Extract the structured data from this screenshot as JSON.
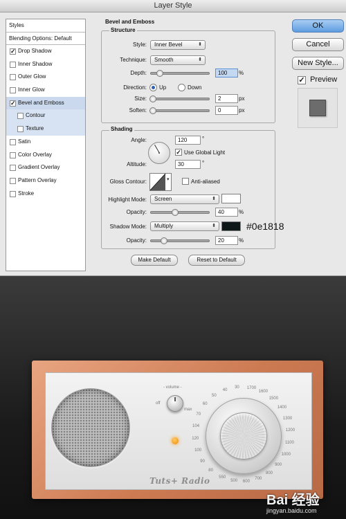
{
  "dialog": {
    "title": "Layer Style",
    "styles_header": "Styles",
    "blending_options": "Blending Options: Default",
    "style_items": [
      {
        "label": "Drop Shadow",
        "checked": true,
        "selected": false,
        "sub": false
      },
      {
        "label": "Inner Shadow",
        "checked": false,
        "selected": false,
        "sub": false
      },
      {
        "label": "Outer Glow",
        "checked": false,
        "selected": false,
        "sub": false
      },
      {
        "label": "Inner Glow",
        "checked": false,
        "selected": false,
        "sub": false
      },
      {
        "label": "Bevel and Emboss",
        "checked": true,
        "selected": true,
        "sub": false
      },
      {
        "label": "Contour",
        "checked": false,
        "selected": true,
        "sub": true
      },
      {
        "label": "Texture",
        "checked": false,
        "selected": true,
        "sub": true
      },
      {
        "label": "Satin",
        "checked": false,
        "selected": false,
        "sub": false
      },
      {
        "label": "Color Overlay",
        "checked": false,
        "selected": false,
        "sub": false
      },
      {
        "label": "Gradient Overlay",
        "checked": false,
        "selected": false,
        "sub": false
      },
      {
        "label": "Pattern Overlay",
        "checked": false,
        "selected": false,
        "sub": false
      },
      {
        "label": "Stroke",
        "checked": false,
        "selected": false,
        "sub": false
      }
    ],
    "section_title": "Bevel and Emboss",
    "structure": {
      "title": "Structure",
      "style_label": "Style:",
      "style_value": "Inner Bevel",
      "technique_label": "Technique:",
      "technique_value": "Smooth",
      "depth_label": "Depth:",
      "depth_value": "100",
      "depth_unit": "%",
      "direction_label": "Direction:",
      "dir_up": "Up",
      "dir_down": "Down",
      "direction_selected": "Up",
      "size_label": "Size:",
      "size_value": "2",
      "size_unit": "px",
      "soften_label": "Soften:",
      "soften_value": "0",
      "soften_unit": "px"
    },
    "shading": {
      "title": "Shading",
      "angle_label": "Angle:",
      "angle_value": "120",
      "angle_unit": "°",
      "use_global_light": "Use Global Light",
      "use_global_light_checked": true,
      "altitude_label": "Altitude:",
      "altitude_value": "30",
      "altitude_unit": "°",
      "gloss_contour_label": "Gloss Contour:",
      "anti_aliased": "Anti-aliased",
      "anti_aliased_checked": false,
      "highlight_mode_label": "Highlight Mode:",
      "highlight_mode_value": "Screen",
      "highlight_color": "#ffffff",
      "opacity_label": "Opacity:",
      "highlight_opacity": "40",
      "highlight_opacity_unit": "%",
      "shadow_mode_label": "Shadow Mode:",
      "shadow_mode_value": "Multiply",
      "shadow_color": "#0e1818",
      "shadow_color_label": "#0e1818",
      "shadow_opacity": "20",
      "shadow_opacity_unit": "%"
    },
    "buttons": {
      "make_default": "Make Default",
      "reset_default": "Reset to Default",
      "ok": "OK",
      "cancel": "Cancel",
      "new_style": "New Style...",
      "preview": "Preview",
      "preview_checked": true
    }
  },
  "radio": {
    "volume_label": "- volume -",
    "off_label": "off",
    "max_label": "max",
    "brand": "Tuts+ Radio",
    "frequencies": [
      "80",
      "90",
      "100",
      "120",
      "104",
      "70",
      "60",
      "50",
      "40",
      "30",
      "1700",
      "1600",
      "1500",
      "1400",
      "1300",
      "1200",
      "1100",
      "1000",
      "900",
      "800",
      "700",
      "600",
      "500",
      "550"
    ]
  },
  "watermark": {
    "logo": "Bai 经验",
    "url": "jingyan.baidu.com"
  }
}
